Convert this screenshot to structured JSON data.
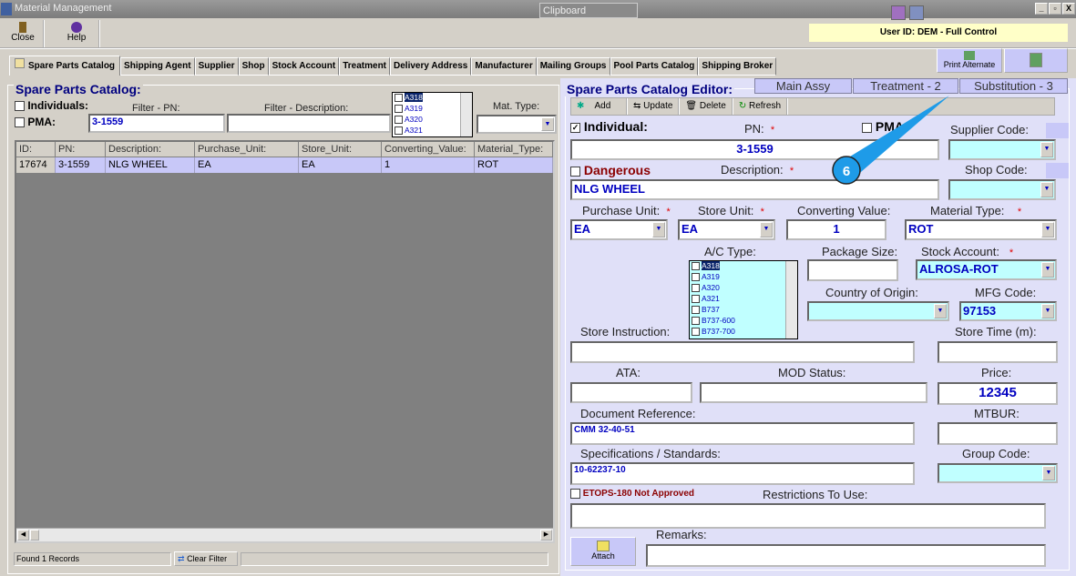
{
  "window": {
    "title": "Material Management",
    "clipboard": "Clipboard",
    "min": "_",
    "restore": "▫",
    "close": "X"
  },
  "toolbar": {
    "close": "Close",
    "help": "Help"
  },
  "user_id": "User ID: DEM - Full Control",
  "tabs": [
    "Spare Parts Catalog",
    "Shipping Agent",
    "Supplier",
    "Shop",
    "Stock Account",
    "Treatment",
    "Delivery Address",
    "Manufacturer",
    "Mailing Groups",
    "Pool Parts Catalog",
    "Shipping Broker"
  ],
  "print_alternate": "Print Alternate",
  "left": {
    "title": "Spare Parts Catalog:",
    "individuals": "Individuals:",
    "pma": "PMA:",
    "filter_pn_label": "Filter - PN:",
    "filter_pn": "3-1559",
    "filter_desc_label": "Filter - Description:",
    "filter_desc": "",
    "ac_list": [
      "A318",
      "A319",
      "A320",
      "A321"
    ],
    "mat_type_label": "Mat. Type:",
    "columns": [
      "ID:",
      "PN:",
      "Description:",
      "Purchase_Unit:",
      "Store_Unit:",
      "Converting_Value:",
      "Material_Type:"
    ],
    "rows": [
      [
        "17674",
        "3-1559",
        "NLG WHEEL",
        "EA",
        "EA",
        "1",
        "ROT"
      ]
    ],
    "status": "Found 1 Records",
    "clear_filter": "Clear Filter"
  },
  "editor": {
    "title": "Spare Parts Catalog Editor:",
    "tabs": [
      "Main Assy",
      "Treatment - 2",
      "Substitution - 3"
    ],
    "tools": {
      "add": "Add",
      "update": "Update",
      "delete": "Delete",
      "refresh": "Refresh"
    },
    "individual": "Individual:",
    "individual_checked": true,
    "pn_label": "PN:",
    "pn": "3-1559",
    "pma": "PMA:",
    "supplier_code": "Supplier Code:",
    "shop_code": "Shop Code:",
    "dangerous": "Dangerous",
    "description_label": "Description:",
    "description": "NLG WHEEL",
    "purchase_unit_label": "Purchase Unit:",
    "purchase_unit": "EA",
    "store_unit_label": "Store Unit:",
    "store_unit": "EA",
    "converting_value_label": "Converting Value:",
    "converting_value": "1",
    "material_type_label": "Material Type:",
    "material_type": "ROT",
    "ac_type_label": "A/C Type:",
    "ac_types": [
      "A318",
      "A319",
      "A320",
      "A321",
      "B737",
      "B737-600",
      "B737-700"
    ],
    "package_size_label": "Package Size:",
    "stock_account_label": "Stock Account:",
    "stock_account": "ALROSA-ROT",
    "country_label": "Country of Origin:",
    "mfg_code_label": "MFG Code:",
    "mfg_code": "97153",
    "store_instruction_label": "Store Instruction:",
    "store_time_label": "Store Time (m):",
    "ata_label": "ATA:",
    "mod_status_label": "MOD Status:",
    "price_label": "Price:",
    "price": "12345",
    "doc_ref_label": "Document Reference:",
    "doc_ref": "CMM 32-40-51",
    "mtbur_label": "MTBUR:",
    "specs_label": "Specifications / Standards:",
    "specs": "10-62237-10",
    "group_code_label": "Group Code:",
    "etops": "ETOPS-180 Not Approved",
    "restrictions_label": "Restrictions To Use:",
    "attach": "Attach",
    "remarks_label": "Remarks:"
  },
  "callout": {
    "number": "6",
    "color": "#1e9be8"
  }
}
